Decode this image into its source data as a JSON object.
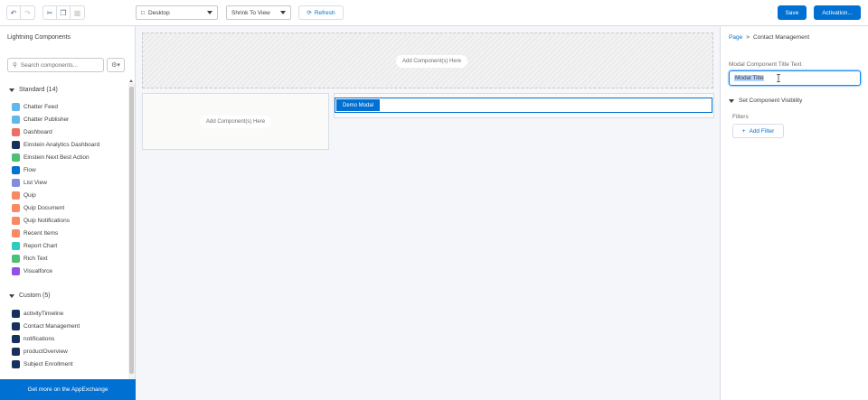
{
  "toolbar": {
    "undo_icon": "undo-icon",
    "redo_icon": "redo-icon",
    "cut_icon": "cut-icon",
    "copy_icon": "copy-icon",
    "paste_icon": "paste-icon",
    "device_select": "Desktop",
    "view_select": "Shrink To View",
    "refresh_label": "Refresh",
    "save_label": "Save",
    "activation_label": "Activation..."
  },
  "left_panel": {
    "title": "Lightning Components",
    "search_placeholder": "Search components...",
    "standard_heading": "Standard (14)",
    "standard_items": [
      {
        "label": "Chatter Feed",
        "color": "#62b7ed"
      },
      {
        "label": "Chatter Publisher",
        "color": "#62b7ed"
      },
      {
        "label": "Dashboard",
        "color": "#ef6e64"
      },
      {
        "label": "Einstein Analytics Dashboard",
        "color": "#16325c"
      },
      {
        "label": "Einstein Next Best Action",
        "color": "#4bc076"
      },
      {
        "label": "Flow",
        "color": "#0070d2"
      },
      {
        "label": "List View",
        "color": "#7f8de1"
      },
      {
        "label": "Quip",
        "color": "#f88962"
      },
      {
        "label": "Quip Document",
        "color": "#f88962"
      },
      {
        "label": "Quip Notifications",
        "color": "#f88962"
      },
      {
        "label": "Recent Items",
        "color": "#f88962"
      },
      {
        "label": "Report Chart",
        "color": "#2ecbbe"
      },
      {
        "label": "Rich Text",
        "color": "#4bc076"
      },
      {
        "label": "Visualforce",
        "color": "#9050e9"
      }
    ],
    "custom_heading": "Custom (5)",
    "custom_items": [
      {
        "label": "activityTimeline",
        "color": "#16325c"
      },
      {
        "label": "Contact Management",
        "color": "#16325c"
      },
      {
        "label": "notifications",
        "color": "#16325c"
      },
      {
        "label": "productOverview",
        "color": "#16325c"
      },
      {
        "label": "Subject Enrollment",
        "color": "#16325c"
      }
    ],
    "appexchange_label": "Get more on the AppExchange"
  },
  "canvas": {
    "top_region_label": "Add Component(s) Here",
    "left_region_label": "Add Component(s) Here",
    "modal_tag": "Demo Modal"
  },
  "right_panel": {
    "crumb_root": "Page",
    "crumb_sep": ">",
    "crumb_current": "Contact Management",
    "title_label": "Modal Component Title Text",
    "title_value": "Modal Title",
    "visibility_heading": "Set Component Visibility",
    "filters_label": "Filters",
    "add_filter_label": "Add Filter"
  },
  "colors": {
    "brand": "#0070d2",
    "border": "#d8dde6",
    "canvas_bg": "#f4f6f9"
  }
}
